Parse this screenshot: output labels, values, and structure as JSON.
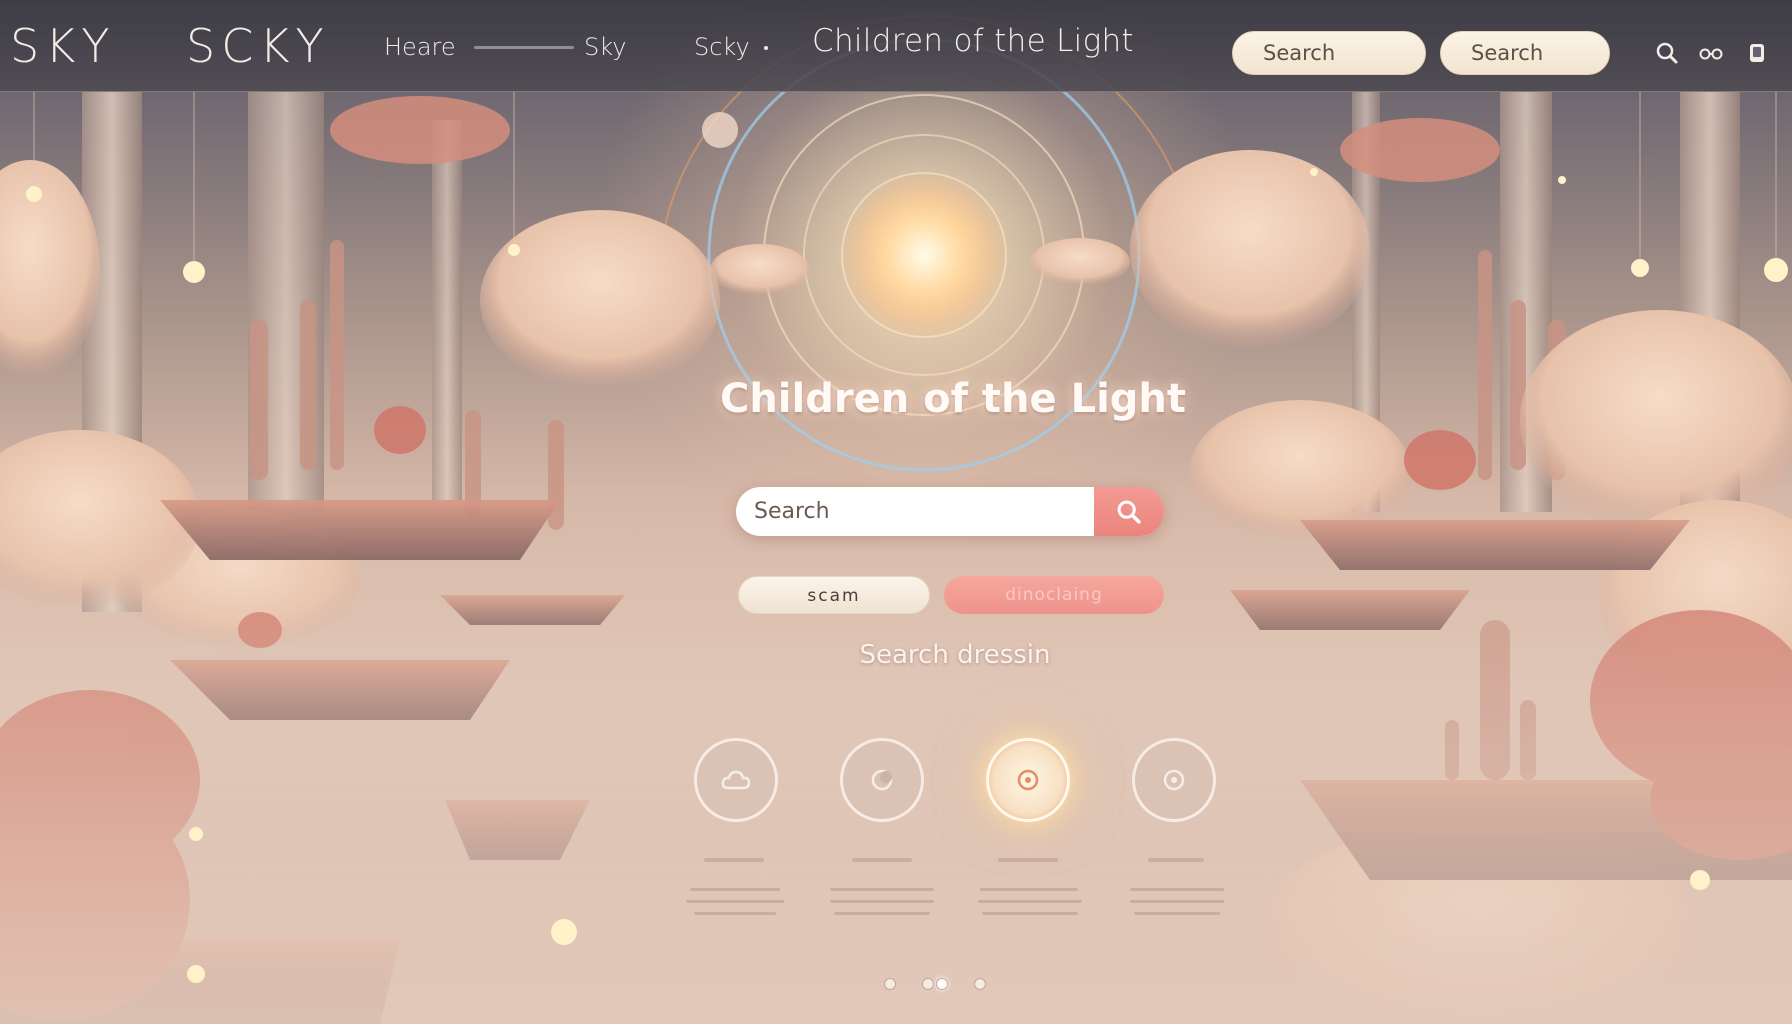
{
  "header": {
    "logo_primary": "SKY",
    "logo_secondary": "SCKY",
    "nav": [
      {
        "label": "Heare"
      },
      {
        "label": "Sky"
      },
      {
        "label": "Scky"
      }
    ],
    "title": "Children of the Light",
    "search_pill_1": "Search",
    "search_pill_2": "Search",
    "icons": [
      "search-icon",
      "glasses-icon",
      "phone-icon"
    ]
  },
  "hero": {
    "title": "Children of the Light",
    "search_placeholder": "Search",
    "chip_1": "scam",
    "chip_2": "dinoclaing",
    "sub_heading": "Search dressin"
  },
  "features": [
    {
      "icon": "cloud-icon",
      "label": "",
      "active": false
    },
    {
      "icon": "moon-icon",
      "label": "",
      "active": false
    },
    {
      "icon": "ring-icon",
      "label": "",
      "active": true
    },
    {
      "icon": "ring-icon",
      "label": "",
      "active": false
    }
  ],
  "pagination": {
    "count": 4,
    "active_index": 2
  },
  "colors": {
    "accent": "#ea857e",
    "cream": "#f6ecdf",
    "header_bg": "#3e3c44",
    "glow": "#ffe8c0"
  }
}
